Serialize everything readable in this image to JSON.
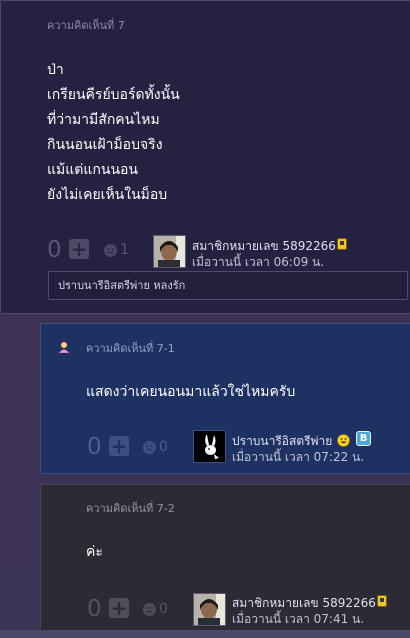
{
  "comment7": {
    "header": "ความคิดเห็นที่ 7",
    "lines": [
      "ป่า",
      "เกรียนคีรย์บอร์ดทั้งนั้น",
      "ที่ว่ามามีสักคนไหม",
      "กินนอนเฝ้าม็อบจริง",
      "แม้แต่แกนนอน",
      "ยังไม่เคยเห็นในม็อบ"
    ],
    "votes": "0",
    "emotion_count": "1",
    "user": "สมาชิกหมายเลข 5892266",
    "time": "เมื่อวานนี้ เวลา 06:09 น.",
    "reply_preview": "ปราบนารีอิสตรีพ่าย หลงรัก"
  },
  "comment7_1": {
    "header": "ความคิดเห็นที่ 7-1",
    "text": "แสดงว่าเคยนอนมาแล้วใช่ไหมครับ",
    "votes": "0",
    "emotion_count": "0",
    "user": "ปราบนารีอิสตรีพ่าย",
    "time": "เมื่อวานนี้ เวลา 07:22 น.",
    "badge_letter": "B"
  },
  "comment7_2": {
    "header": "ความคิดเห็นที่ 7-2",
    "text": "ค่ะ",
    "votes": "0",
    "emotion_count": "0",
    "user": "สมาชิกหมายเลข 5892266",
    "time": "เมื่อวานนี้ เวลา 07:41 น."
  },
  "icons": {
    "plus": "+",
    "emotion": "emotion-face-icon",
    "owner": "owner-icon",
    "phone": "mobile-icon",
    "smile": "smile-icon",
    "bunny": "playboy-bunny-avatar"
  },
  "colors": {
    "card_main": "#252140",
    "card_reply_highlight": "#1d3163",
    "card_reply": "#2c2a33"
  }
}
